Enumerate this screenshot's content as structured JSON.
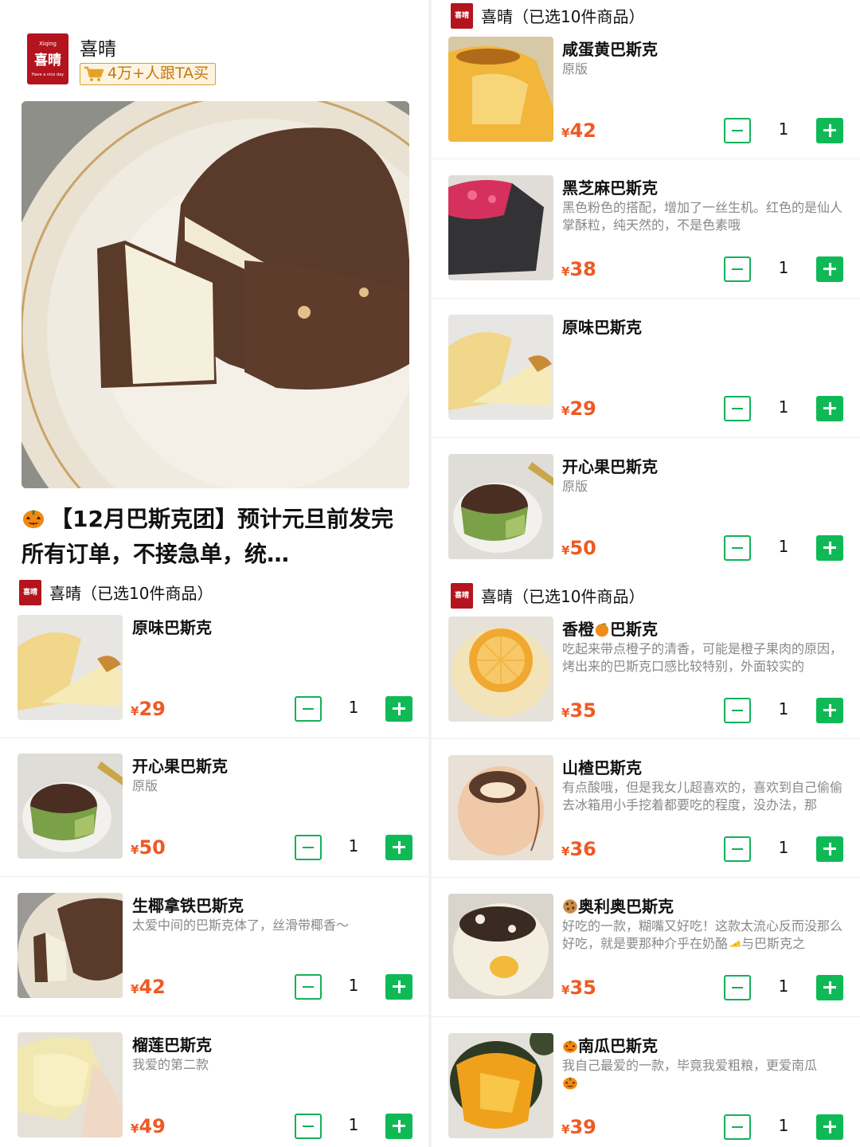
{
  "left": {
    "shop": {
      "logo_top": "Xiqing",
      "logo_main": "喜晴",
      "logo_bottom": "Have a nice day",
      "name": "喜晴",
      "buyers_badge": "4万+人跟TA买"
    },
    "hero_title": "【12月巴斯克团】预计元旦前发完所有订单，不接急单，统…",
    "group": {
      "mini_logo": "喜晴",
      "label": "喜晴（已选10件商品）"
    },
    "items": [
      {
        "name": "原味巴斯克",
        "desc": "",
        "currency": "¥",
        "price": "29",
        "qty": "1"
      },
      {
        "name": "开心果巴斯克",
        "desc": "原版",
        "currency": "¥",
        "price": "50",
        "qty": "1"
      },
      {
        "name": "生椰拿铁巴斯克",
        "desc": "太爱中间的巴斯克体了，丝滑带椰香～",
        "currency": "¥",
        "price": "42",
        "qty": "1"
      },
      {
        "name": "榴莲巴斯克",
        "desc": "我爱的第二款",
        "currency": "¥",
        "price": "49",
        "qty": "1"
      }
    ]
  },
  "right": {
    "group_top": {
      "mini_logo": "喜晴",
      "label": "喜晴（已选10件商品）"
    },
    "items_a": [
      {
        "name": "咸蛋黄巴斯克",
        "desc": "原版",
        "currency": "¥",
        "price": "42",
        "qty": "1"
      },
      {
        "name": "黑芝麻巴斯克",
        "desc": "黑色粉色的搭配，增加了一丝生机。红色的是仙人掌酥粒，纯天然的，不是色素哦",
        "currency": "¥",
        "price": "38",
        "qty": "1"
      },
      {
        "name": "原味巴斯克",
        "desc": "",
        "currency": "¥",
        "price": "29",
        "qty": "1"
      },
      {
        "name": "开心果巴斯克",
        "desc": "原版",
        "currency": "¥",
        "price": "50",
        "qty": "1"
      }
    ],
    "group_mid": {
      "mini_logo": "喜晴",
      "label": "喜晴（已选10件商品）"
    },
    "items_b": [
      {
        "name_pre": "香橙",
        "name_post": "巴斯克",
        "desc": "吃起来带点橙子的清香，可能是橙子果肉的原因，烤出来的巴斯克口感比较特别，外面较实的",
        "currency": "¥",
        "price": "35",
        "qty": "1"
      },
      {
        "name": "山楂巴斯克",
        "desc": "有点酸哦，但是我女儿超喜欢的，喜欢到自己偷偷去冰箱用小手挖着都要吃的程度，没办法，那",
        "currency": "¥",
        "price": "36",
        "qty": "1"
      },
      {
        "name": "奥利奥巴斯克",
        "desc_pre": "好吃的一款，糊嘴又好吃！这款太流心反而没那么好吃，就是要那种介乎在奶酪",
        "desc_post": "与巴斯克之",
        "currency": "¥",
        "price": "35",
        "qty": "1"
      },
      {
        "name": "南瓜巴斯克",
        "desc": "我自己最爱的一款，毕竟我爱粗粮，更爱南瓜",
        "currency": "¥",
        "price": "39",
        "qty": "1"
      }
    ]
  },
  "colors": {
    "green": "#0fba56",
    "price": "#ee5a24",
    "brand_red": "#b3141d",
    "badge": "#c27a12"
  },
  "icons": [
    "cart-icon",
    "pumpkin-icon",
    "orange-icon",
    "cookie-icon",
    "cheese-icon",
    "minus-icon",
    "plus-icon"
  ]
}
